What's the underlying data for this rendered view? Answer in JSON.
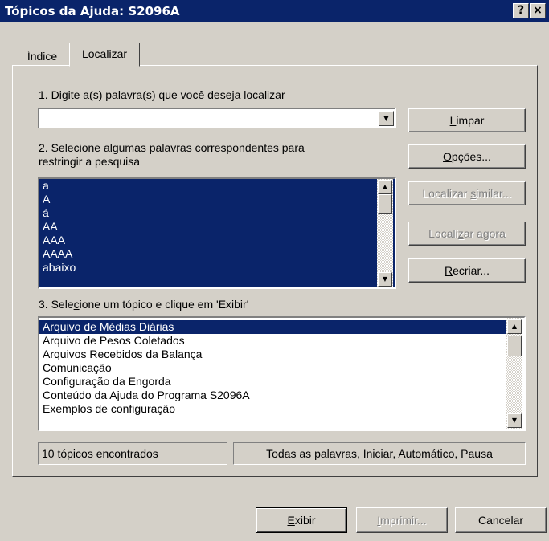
{
  "window": {
    "title": "Tópicos da Ajuda: S2096A",
    "help_button": "?",
    "close_button": "×"
  },
  "tabs": [
    {
      "label": "Índice"
    },
    {
      "label": "Localizar"
    }
  ],
  "step1": {
    "label_pre": "1. ",
    "label_u": "D",
    "label_post": "igite a(s) palavra(s) que você deseja localizar",
    "search_value": ""
  },
  "step2": {
    "label_line1_pre": "2. Selecione ",
    "label_line1_u": "a",
    "label_line1_post": "lgumas palavras correspondentes para",
    "label_line2": "restringir a pesquisa",
    "words": [
      "a",
      "A",
      "à",
      "AA",
      "AAA",
      "AAAA",
      "abaixo"
    ]
  },
  "step3": {
    "label_pre": "3. Sele",
    "label_u": "c",
    "label_post": "ione um tópico e clique em 'Exibir'",
    "topics": [
      "Arquivo de Médias Diárias",
      "Arquivo de Pesos Coletados",
      "Arquivos Recebidos da Balança",
      "Comunicação",
      "Configuração da Engorda",
      "Conteúdo da Ajuda do Programa S2096A",
      "Exemplos de configuração"
    ],
    "selected_topic": "Arquivo de Médias Diárias"
  },
  "buttons": {
    "limpar": {
      "u": "L",
      "rest": "impar"
    },
    "opcoes": {
      "u": "O",
      "rest": "pções..."
    },
    "localizar_similar": {
      "pre": "Localizar ",
      "u": "s",
      "rest": "imilar..."
    },
    "localizar_agora": {
      "pre": "Locali",
      "u": "z",
      "rest": "ar agora"
    },
    "recriar": {
      "u": "R",
      "rest": "ecriar..."
    },
    "exibir": {
      "u": "E",
      "rest": "xibir"
    },
    "imprimir": {
      "u": "I",
      "rest": "mprimir..."
    },
    "cancelar": "Cancelar"
  },
  "status": {
    "count": "10 tópicos encontrados",
    "options": "Todas as palavras, Iniciar, Automático, Pausa"
  }
}
